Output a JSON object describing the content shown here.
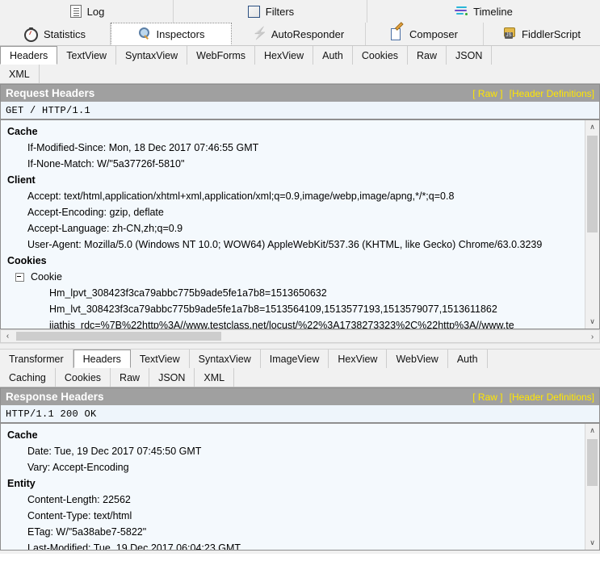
{
  "toolbar": {
    "row1": [
      {
        "label": "Log",
        "icon": "log-icon",
        "selected": false
      },
      {
        "label": "Filters",
        "icon": "filters-icon",
        "selected": false
      },
      {
        "label": "Timeline",
        "icon": "timeline-icon",
        "selected": false
      }
    ],
    "row2": [
      {
        "label": "Statistics",
        "icon": "stopwatch-icon",
        "selected": false
      },
      {
        "label": "Inspectors",
        "icon": "magnifier-icon",
        "selected": true
      },
      {
        "label": "AutoResponder",
        "icon": "lightning-icon",
        "selected": false
      },
      {
        "label": "Composer",
        "icon": "notepad-pencil-icon",
        "selected": false
      },
      {
        "label": "FiddlerScript",
        "icon": "script-js-icon",
        "selected": false
      }
    ]
  },
  "request_tabs": {
    "row1": [
      "Headers",
      "TextView",
      "SyntaxView",
      "WebForms",
      "HexView",
      "Auth",
      "Cookies",
      "Raw",
      "JSON"
    ],
    "row2": [
      "XML"
    ],
    "selected": "Headers"
  },
  "request_panel": {
    "title": "Request Headers",
    "raw_link": "[ Raw ]",
    "header_definitions_link": "[Header Definitions]",
    "request_line": "GET / HTTP/1.1",
    "groups": [
      {
        "name": "Cache",
        "items": [
          "If-Modified-Since: Mon, 18 Dec 2017 07:46:55 GMT",
          "If-None-Match: W/\"5a37726f-5810\""
        ]
      },
      {
        "name": "Client",
        "items": [
          "Accept: text/html,application/xhtml+xml,application/xml;q=0.9,image/webp,image/apng,*/*;q=0.8",
          "Accept-Encoding: gzip, deflate",
          "Accept-Language: zh-CN,zh;q=0.9",
          "User-Agent: Mozilla/5.0 (Windows NT 10.0; WOW64) AppleWebKit/537.36 (KHTML, like Gecko) Chrome/63.0.3239"
        ]
      },
      {
        "name": "Cookies",
        "node": "Cookie",
        "subitems": [
          "Hm_lpvt_308423f3ca79abbc775b9ade5fe1a7b8=1513650632",
          "Hm_lvt_308423f3ca79abbc775b9ade5fe1a7b8=1513564109,1513577193,1513579077,1513611862",
          "jiathis_rdc=%7B%22http%3A//www.testclass.net/locust/%22%3A1738273323%2C%22http%3A//www.te"
        ]
      }
    ]
  },
  "response_tabs": {
    "row1": [
      "Transformer",
      "Headers",
      "TextView",
      "SyntaxView",
      "ImageView",
      "HexView",
      "WebView",
      "Auth"
    ],
    "row2": [
      "Caching",
      "Cookies",
      "Raw",
      "JSON",
      "XML"
    ],
    "selected": "Headers"
  },
  "response_panel": {
    "title": "Response Headers",
    "raw_link": "[ Raw ]",
    "header_definitions_link": "[Header Definitions]",
    "status_line": "HTTP/1.1 200 OK",
    "groups": [
      {
        "name": "Cache",
        "items": [
          "Date: Tue, 19 Dec 2017 07:45:50 GMT",
          "Vary: Accept-Encoding"
        ]
      },
      {
        "name": "Entity",
        "items": [
          "Content-Length: 22562",
          "Content-Type: text/html",
          "ETag: W/\"5a38abe7-5822\"",
          "Last-Modified: Tue, 19 Dec 2017 06:04:23 GMT"
        ]
      }
    ]
  },
  "scroll": {
    "left_arrow": "‹",
    "right_arrow": "›",
    "up_arrow": "∧",
    "down_arrow": "∨"
  },
  "colors": {
    "panel_title_bg": "#a0a0a0",
    "panel_title_fg": "#ffffff",
    "link": "#ffe600",
    "header_bg": "#f4f9fd",
    "toolbar_bg": "#f1f1f1"
  }
}
